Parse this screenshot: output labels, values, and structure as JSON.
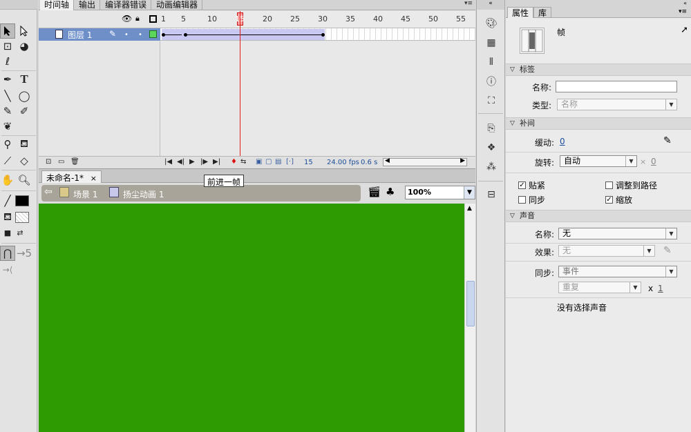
{
  "timeline": {
    "tabs": [
      "时间轴",
      "输出",
      "编译器错误",
      "动画编辑器"
    ],
    "ruler": [
      "1",
      "5",
      "10",
      "15",
      "20",
      "25",
      "30",
      "35",
      "40",
      "45",
      "50",
      "55"
    ],
    "layer_name": "图层 1",
    "current_frame": "15",
    "fps": "24.00 fps",
    "elapsed": "0.6 s"
  },
  "tooltip": "前进一帧",
  "document": {
    "tab": "未命名-1*",
    "tab_close": "×",
    "scene": "场景 1",
    "symbol": "扬尘动画 1",
    "zoom": "100%",
    "stage_color": "#2e9b00"
  },
  "props": {
    "tabs": [
      "属性",
      "库"
    ],
    "frame_title": "帧",
    "label": {
      "section": "标签",
      "name_label": "名称:",
      "name_value": "",
      "type_label": "类型:",
      "type_value": "名称"
    },
    "tween": {
      "section": "补间",
      "ease_label": "缓动:",
      "ease_value": "0",
      "rotate_label": "旋转:",
      "rotate_value": "自动",
      "rotate_x": "×",
      "rotate_count": "0",
      "snap": "贴紧",
      "orient": "调整到路径",
      "sync": "同步",
      "scale": "缩放"
    },
    "sound": {
      "section": "声音",
      "name_label": "名称:",
      "name_value": "无",
      "effect_label": "效果:",
      "effect_value": "无",
      "sync_label": "同步:",
      "sync_value": "事件",
      "repeat_value": "重复",
      "x": "x",
      "repeat_count": "1",
      "no_sound": "没有选择声音"
    }
  }
}
